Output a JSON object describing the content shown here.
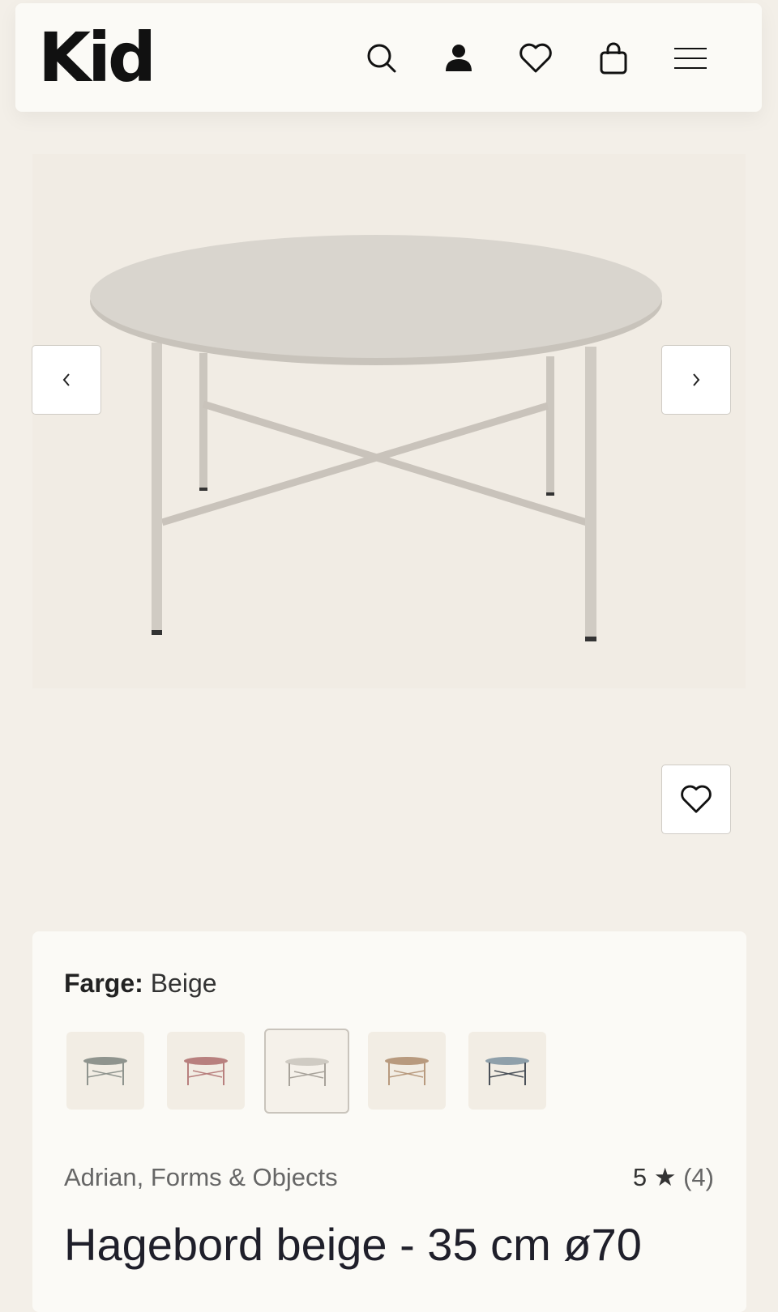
{
  "header": {
    "logo": "Kid"
  },
  "product": {
    "color_label": "Farge:",
    "color_value": "Beige",
    "swatches": [
      {
        "name": "grey",
        "color": "#8f948e"
      },
      {
        "name": "pink",
        "color": "#b8807e"
      },
      {
        "name": "beige",
        "color": "#cfcbc3",
        "selected": true
      },
      {
        "name": "sand",
        "color": "#b89a7e"
      },
      {
        "name": "blue",
        "color": "#7f8f99"
      }
    ],
    "brand": "Adrian, Forms & Objects",
    "rating_value": "5",
    "rating_star": "★",
    "rating_count": "(4)",
    "title": "Hagebord beige - 35 cm ø70"
  },
  "icons": {
    "search": "search-icon",
    "account": "user-icon",
    "wishlist": "heart-icon",
    "cart": "bag-icon",
    "menu": "hamburger-menu-icon",
    "prev": "chevron-left-icon",
    "next": "chevron-right-icon"
  }
}
